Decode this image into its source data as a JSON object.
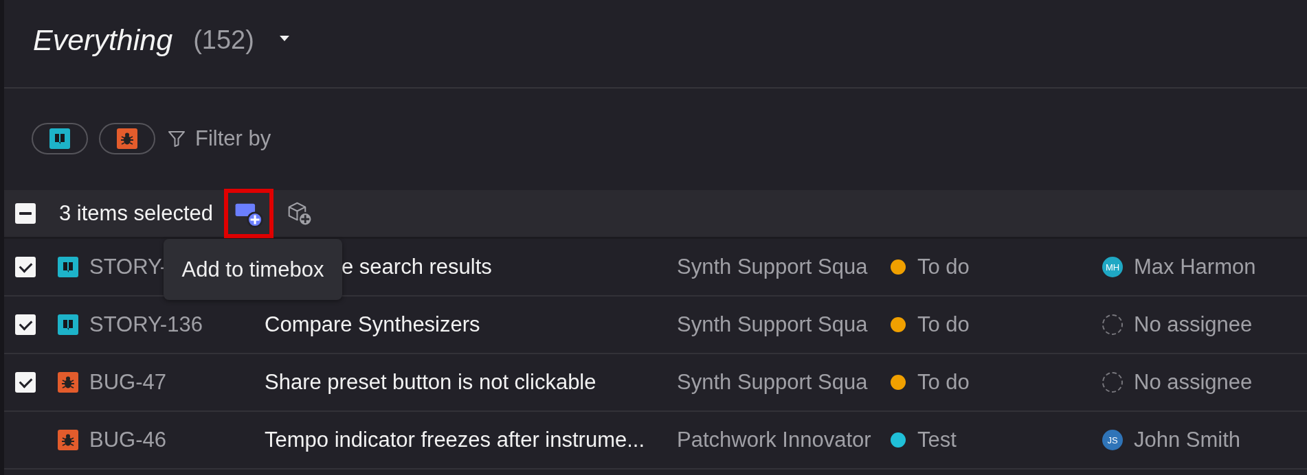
{
  "view": {
    "title": "Everything",
    "count": "(152)"
  },
  "filters": {
    "chips": [
      {
        "kind": "story"
      },
      {
        "kind": "bug"
      }
    ],
    "label": "Filter by"
  },
  "selection_bar": {
    "partial": true,
    "label": "3 items selected",
    "actions": [
      {
        "kind": "timebox",
        "highlighted": true
      },
      {
        "kind": "box",
        "highlighted": false
      }
    ]
  },
  "tooltip": {
    "text": "Add to timebox"
  },
  "rows": [
    {
      "checked": true,
      "kind": "story",
      "key": "STORY-",
      "title": "e search results",
      "partly_hidden": true,
      "team": "Synth Support Squa",
      "status": "To do",
      "color": "#f0a000",
      "assignee": {
        "kind": "person",
        "initials": "MH",
        "color": "#1fa8c4",
        "name": "Max Harmon"
      }
    },
    {
      "checked": true,
      "kind": "story",
      "key": "STORY-136",
      "title": "Compare Synthesizers",
      "partly_hidden": false,
      "team": "Synth Support Squa",
      "status": "To do",
      "color": "#f0a000",
      "assignee": {
        "kind": "none",
        "name": "No assignee"
      }
    },
    {
      "checked": true,
      "kind": "bug",
      "key": "BUG-47",
      "title": "Share preset button is not clickable",
      "partly_hidden": false,
      "team": "Synth Support Squa",
      "status": "To do",
      "color": "#f0a000",
      "assignee": {
        "kind": "none",
        "name": "No assignee"
      }
    },
    {
      "checked": false,
      "kind": "bug",
      "key": "BUG-46",
      "title": "Tempo indicator freezes after instrume...",
      "partly_hidden": false,
      "team": "Patchwork Innovator",
      "status": "Test",
      "color": "#20c0d8",
      "assignee": {
        "kind": "person",
        "initials": "JS",
        "color": "#2f74b8",
        "name": "John Smith"
      }
    }
  ]
}
